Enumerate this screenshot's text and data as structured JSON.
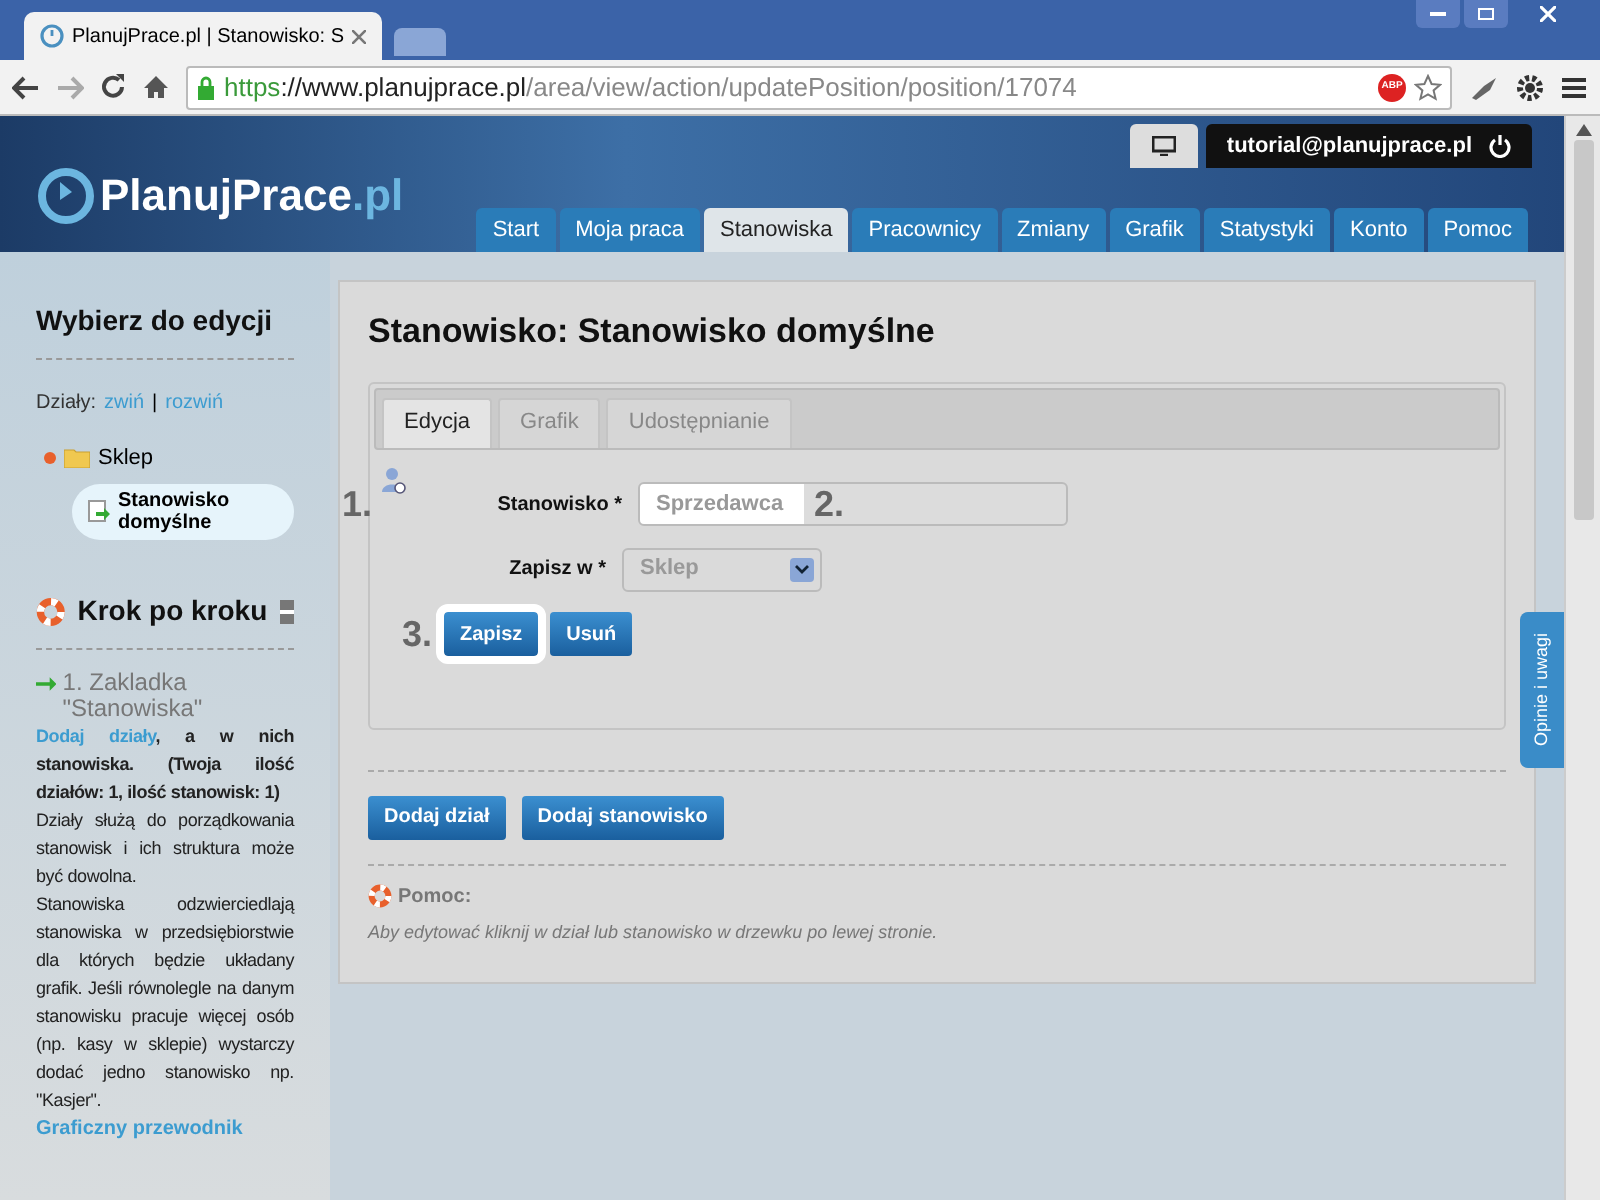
{
  "browser": {
    "tab_title": "PlanujPrace.pl | Stanowisko: S",
    "url_scheme": "https",
    "url_host": "://www.planujprace.pl",
    "url_path": "/area/view/action/updatePosition/position/17074",
    "adblock_label": "ABP"
  },
  "header": {
    "logo_main": "PlanujPrace",
    "logo_suffix": ".pl",
    "user": "tutorial@planujprace.pl",
    "nav": [
      {
        "label": "Start",
        "selected": false
      },
      {
        "label": "Moja praca",
        "selected": false
      },
      {
        "label": "Stanowiska",
        "selected": true
      },
      {
        "label": "Pracownicy",
        "selected": false
      },
      {
        "label": "Zmiany",
        "selected": false
      },
      {
        "label": "Grafik",
        "selected": false
      },
      {
        "label": "Statystyki",
        "selected": false
      },
      {
        "label": "Konto",
        "selected": false
      },
      {
        "label": "Pomoc",
        "selected": false
      }
    ]
  },
  "sidebar": {
    "title": "Wybierz do edycji",
    "departments_label": "Działy:",
    "collapse": "zwiń",
    "separator": "|",
    "expand": "rozwiń",
    "tree": [
      {
        "label": "Sklep",
        "expanded": true,
        "selected": false,
        "children": [
          {
            "label": "Stanowisko domyślne",
            "selected": true
          }
        ]
      }
    ],
    "guide_title": "Krok po kroku",
    "step_title": "1. Zakladka \"Stanowiska\"",
    "step_text": [
      {
        "kind": "lead",
        "link": "Dodaj działy",
        "text": ", a w nich stanowiska. (Twoja ilość działów: 1, ilość stanowisk: 1)"
      },
      {
        "kind": "plain",
        "text": "Działy służą do porządkowania stanowisk i ich struktura może być dowolna."
      },
      {
        "kind": "plain",
        "text": "Stanowiska odzwierciedlają stanowiska w przedsiębiorstwie dla których będzie układany grafik. Jeśli równolegle na danym stanowisku pracuje więcej osób (np. kasy w sklepie) wystarczy dodać jedno stanowisko np. \"Kasjer\"."
      }
    ],
    "guide_link": "Graficzny przewodnik"
  },
  "main": {
    "title": "Stanowisko: Stanowisko domyślne",
    "tabs": [
      {
        "label": "Edycja",
        "selected": true
      },
      {
        "label": "Grafik",
        "selected": false
      },
      {
        "label": "Udostępnianie",
        "selected": false
      }
    ],
    "fields": [
      {
        "kind": "input",
        "label": "Stanowisko *",
        "placeholder": "Sprzedawca"
      },
      {
        "kind": "select",
        "label": "Zapisz w *",
        "value": "Sklep"
      }
    ],
    "buttons": [
      {
        "label": "Zapisz",
        "highlighted": true
      },
      {
        "label": "Usuń",
        "highlighted": false
      }
    ],
    "markers": [
      "1.",
      "2.",
      "3."
    ],
    "actions": [
      "Dodaj dział",
      "Dodaj stanowisko"
    ],
    "help_title": "Pomoc:",
    "help_text": "Aby edytować kliknij w dział lub stanowisko w drzewku po lewej stronie."
  },
  "feedback_tab": "Opinie i uwagi"
}
